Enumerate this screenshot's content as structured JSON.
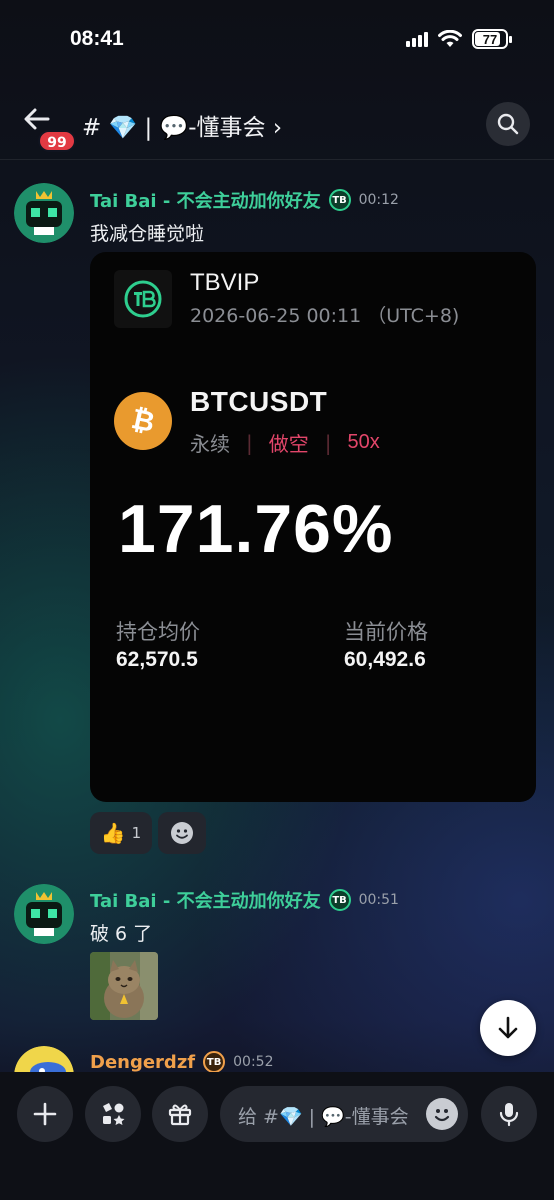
{
  "status_bar": {
    "time": "08:41",
    "battery": "77"
  },
  "header": {
    "unread_badge": "99",
    "channel_title": "# 💎 | 💬-懂事会 ›"
  },
  "messages": [
    {
      "author": "Tai Bai - 不会主动加你好友",
      "role_icon": "TB",
      "time": "00:12",
      "text": "我减仓睡觉啦"
    },
    {
      "author": "Tai Bai - 不会主动加你好友",
      "role_icon": "TB",
      "time": "00:51",
      "text": "破 6 了"
    },
    {
      "author": "Dengerdzf",
      "role_icon": "TB",
      "time": "00:52"
    }
  ],
  "card": {
    "brand": "TBVIP",
    "date": "2026-06-25 00:11 （UTC+8)",
    "pair": "BTCUSDT",
    "tag_perp": "永续",
    "tag_sep": "|",
    "tag_direction": "做空",
    "tag_leverage": "50x",
    "pnl": "171.76%",
    "entry_label": "持仓均价",
    "entry_value": "62,570.5",
    "current_label": "当前价格",
    "current_value": "60,492.6"
  },
  "reactions": [
    {
      "emoji": "👍",
      "count": "1"
    }
  ],
  "composer": {
    "placeholder": "给 #💎 | 💬-懂事会"
  },
  "colors": {
    "author_green": "#3ecf9a",
    "author_orange": "#f0a04b",
    "short_red": "#e2466a",
    "bitcoin_orange": "#e99a2e",
    "badge_red": "#e23a43"
  }
}
